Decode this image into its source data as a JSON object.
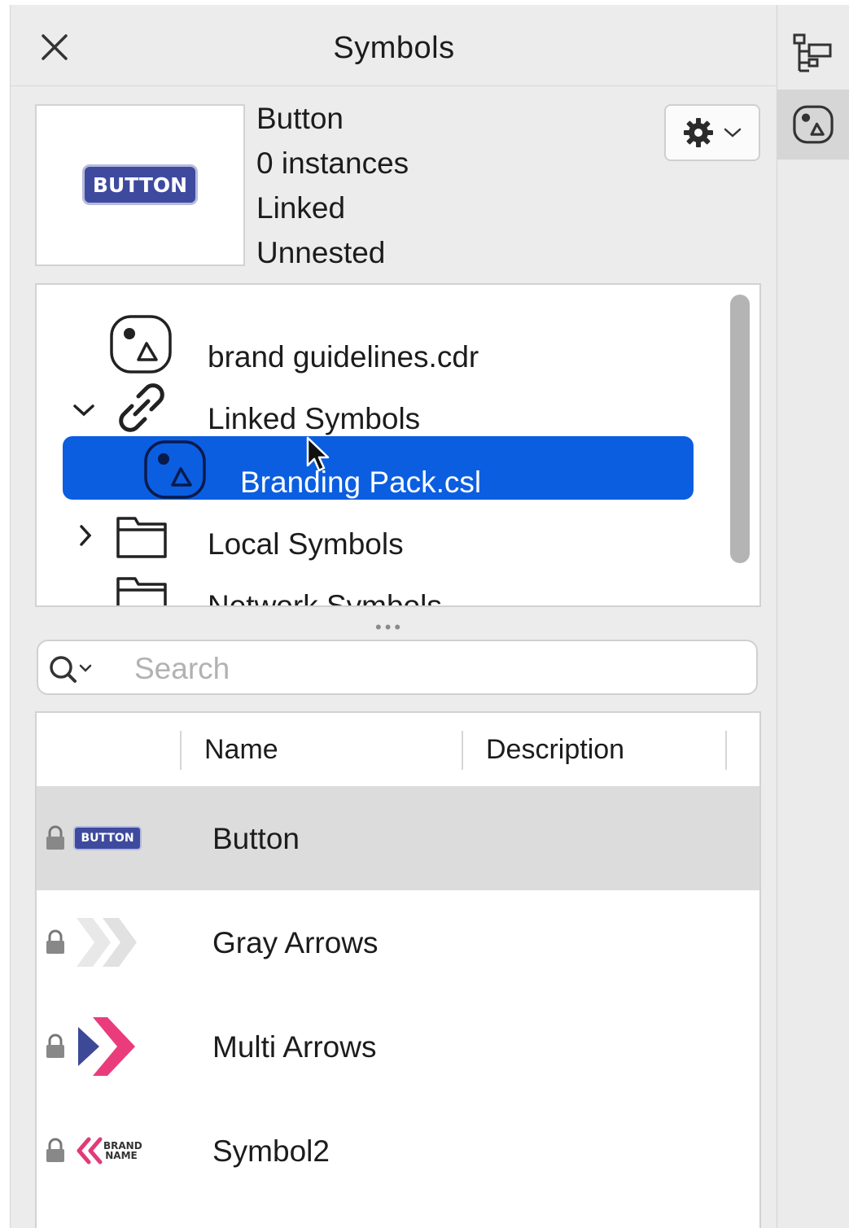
{
  "panel": {
    "title": "Symbols"
  },
  "symbol_info": {
    "name": "Button",
    "instances": "0 instances",
    "link_status": "Linked",
    "nesting": "Unnested",
    "thumbnail_text": "BUTTON"
  },
  "tree": {
    "items": [
      {
        "label": "brand guidelines.cdr",
        "icon": "symbol-file-icon"
      },
      {
        "label": "Linked Symbols",
        "icon": "link-icon",
        "expanded": true
      },
      {
        "label": "Branding Pack.csl",
        "icon": "symbol-file-icon",
        "selected": true
      },
      {
        "label": "Local Symbols",
        "icon": "folder-icon",
        "expanded": false
      },
      {
        "label": "Network Symbols",
        "icon": "folder-icon"
      }
    ]
  },
  "search": {
    "placeholder": "Search"
  },
  "list": {
    "columns": [
      "Name",
      "Description"
    ],
    "rows": [
      {
        "name": "Button",
        "description": "",
        "thumbnail": "button-thumb",
        "thumb_text": "BUTTON",
        "selected": true
      },
      {
        "name": "Gray Arrows",
        "description": "",
        "thumbnail": "gray-arrows-thumb"
      },
      {
        "name": "Multi Arrows",
        "description": "",
        "thumbnail": "multi-arrows-thumb"
      },
      {
        "name": "Symbol2",
        "description": "",
        "thumbnail": "symbol2-thumb",
        "thumb_text": "BRAND NAME"
      }
    ]
  },
  "colors": {
    "selection": "#0b5ee0",
    "button_badge": "#3e4a9e",
    "multi_arrow_pink": "#ea3c7d",
    "multi_arrow_blue": "#3d4897",
    "panel_bg": "#ececec"
  }
}
